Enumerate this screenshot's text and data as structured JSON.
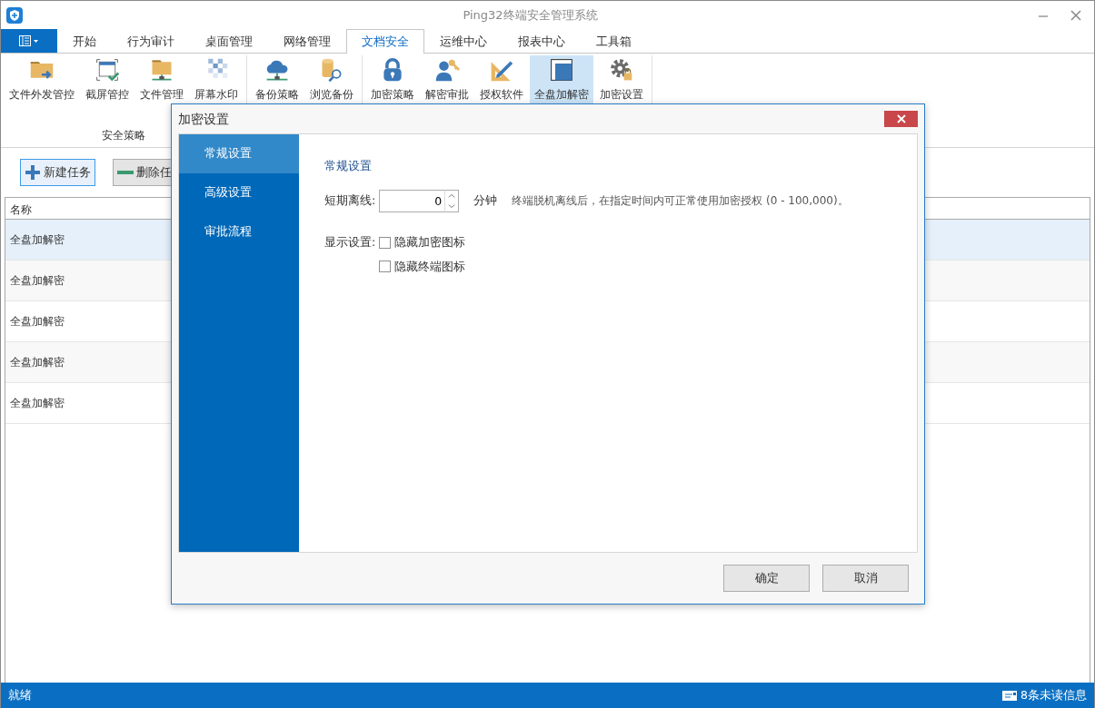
{
  "window": {
    "title": "Ping32终端安全管理系统"
  },
  "tabs": [
    {
      "label": "开始",
      "selected": false
    },
    {
      "label": "行为审计",
      "selected": false
    },
    {
      "label": "桌面管理",
      "selected": false
    },
    {
      "label": "网络管理",
      "selected": false
    },
    {
      "label": "文档安全",
      "selected": true
    },
    {
      "label": "运维中心",
      "selected": false
    },
    {
      "label": "报表中心",
      "selected": false
    },
    {
      "label": "工具箱",
      "selected": false
    }
  ],
  "ribbon": {
    "groups": [
      {
        "label": "安全策略",
        "items": [
          {
            "label": "文件外发管控",
            "selected": false
          },
          {
            "label": "截屏管控",
            "selected": false
          },
          {
            "label": "文件管理",
            "selected": false
          },
          {
            "label": "屏幕水印",
            "selected": false
          }
        ]
      },
      {
        "items": [
          {
            "label": "备份策略",
            "selected": false
          },
          {
            "label": "浏览备份",
            "selected": false
          }
        ]
      },
      {
        "items": [
          {
            "label": "加密策略",
            "selected": false
          },
          {
            "label": "解密审批",
            "selected": false
          },
          {
            "label": "授权软件",
            "selected": false
          },
          {
            "label": "全盘加解密",
            "selected": true
          },
          {
            "label": "加密设置",
            "selected": false
          }
        ]
      }
    ]
  },
  "toolbar": [
    {
      "label": "新建任务",
      "kind": "add",
      "focused": true
    },
    {
      "label": "删除任",
      "kind": "remove",
      "focused": false
    }
  ],
  "table": {
    "columns": [
      "名称"
    ],
    "rows": [
      {
        "cells": [
          "全盘加解密"
        ],
        "selected": true
      },
      {
        "cells": [
          "全盘加解密"
        ],
        "selected": false
      },
      {
        "cells": [
          "全盘加解密"
        ],
        "selected": false
      },
      {
        "cells": [
          "全盘加解密"
        ],
        "selected": false
      },
      {
        "cells": [
          "全盘加解密"
        ],
        "selected": false
      }
    ]
  },
  "dialog": {
    "title": "加密设置",
    "nav": [
      {
        "label": "常规设置",
        "selected": true
      },
      {
        "label": "高级设置",
        "selected": false
      },
      {
        "label": "审批流程",
        "selected": false
      }
    ],
    "section_title": "常规设置",
    "offline": {
      "label": "短期离线:",
      "value": "0",
      "unit": "分钟",
      "hint": "终端脱机离线后，在指定时间内可正常使用加密授权 (0 - 100,000)。"
    },
    "display": {
      "label": "显示设置:",
      "options": [
        {
          "label": "隐藏加密图标",
          "checked": false
        },
        {
          "label": "隐藏终端图标",
          "checked": false
        }
      ]
    },
    "buttons": [
      "确定",
      "取消"
    ]
  },
  "status_bar": {
    "text": "就绪",
    "messages": "8条未读信息"
  }
}
